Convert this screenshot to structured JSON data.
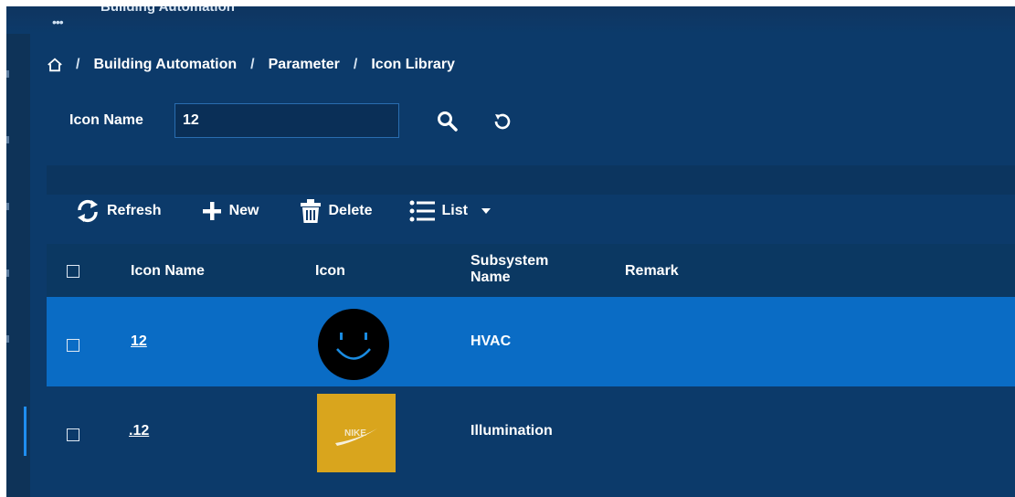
{
  "app": {
    "title": "Building Automation",
    "menu_icon": "grid-dots-icon"
  },
  "breadcrumb": {
    "home_icon": "home-icon",
    "sep": "/",
    "items": [
      "Building Automation",
      "Parameter",
      "Icon Library"
    ]
  },
  "search": {
    "label": "Icon Name",
    "value": "12",
    "search_icon": "search-icon",
    "reset_icon": "reset-icon"
  },
  "toolbar": {
    "refresh": "Refresh",
    "new": "New",
    "delete": "Delete",
    "list": "List"
  },
  "table": {
    "headers": {
      "icon_name": "Icon Name",
      "icon": "Icon",
      "subsystem_line1": "Subsystem",
      "subsystem_line2": "Name",
      "remark": "Remark"
    },
    "rows": [
      {
        "icon_name": "12",
        "icon": "smiley-icon",
        "subsystem": "HVAC",
        "remark": ""
      },
      {
        "icon_name": ".12",
        "icon": "swoosh-logo-icon",
        "subsystem": "Illumination",
        "remark": ""
      }
    ]
  },
  "colors": {
    "background": "#0c3a6a",
    "selected_row": "#0a6cc5",
    "accent": "#1f8ef0",
    "tile_yellow": "#d9a51d"
  }
}
